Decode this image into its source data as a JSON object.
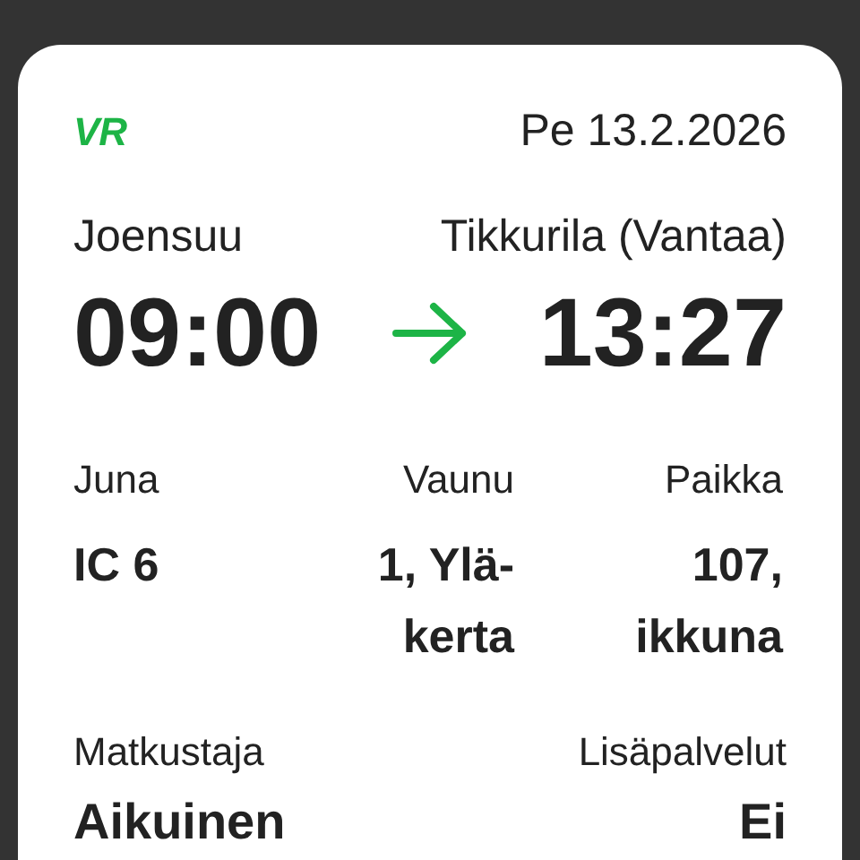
{
  "ticket": {
    "logo": "VR",
    "date": "Pe 13.2.2026",
    "from": {
      "station": "Joensuu",
      "time": "09:00"
    },
    "to": {
      "station": "Tikkurila (Vantaa)",
      "time": "13:27"
    },
    "details": [
      {
        "label": "Juna",
        "value": "IC 6"
      },
      {
        "label": "Vaunu",
        "value": "1, Ylä-kerta"
      },
      {
        "label": "Paikka",
        "value": "107, ikkuna"
      }
    ],
    "passenger": {
      "label": "Matkustaja",
      "value": "Aikuinen"
    },
    "extras": {
      "label": "Lisäpalvelut",
      "value": "Ei"
    }
  }
}
